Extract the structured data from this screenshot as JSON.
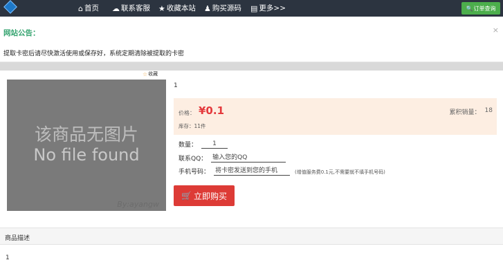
{
  "nav": {
    "items": [
      {
        "icon": "home-icon",
        "glyph": "🏠",
        "label": "首页"
      },
      {
        "icon": "support-icon",
        "glyph": "☁",
        "label": "联系客服"
      },
      {
        "icon": "star-icon",
        "glyph": "★",
        "label": "收藏本站"
      },
      {
        "icon": "users-icon",
        "glyph": "👥",
        "label": "购买源码"
      },
      {
        "icon": "more-icon",
        "glyph": "▤",
        "label": "更多>>"
      }
    ],
    "order_query_label": "订单查询"
  },
  "notice": {
    "title": "网站公告：",
    "close": "×",
    "text": "提取卡密后请尽快激活使用或保存好，系统定期清除被提取的卡密"
  },
  "product": {
    "favorite_label": "收藏",
    "image_text_cn": "该商品无图片",
    "image_text_en": "No file found",
    "image_signature": "By:ayangw",
    "name": "1",
    "price_label": "价格：",
    "price_value": "¥0.1",
    "sales_label": "累积销量：",
    "sales_value": "18",
    "stock_text": "库存：11件",
    "qty_label": "数量：",
    "qty_value": "1",
    "qq_label": "联系QQ：",
    "qq_placeholder": "输入您的QQ",
    "phone_label": "手机号码：",
    "phone_placeholder": "将卡密发送到您的手机",
    "phone_note": "(增值服务费0.1元,不需要就不填手机号码)",
    "buy_label": "立即购买"
  },
  "description": {
    "title": "商品描述",
    "content": "1"
  },
  "colors": {
    "navbar": "#2c3440",
    "accent_green": "#34a36f",
    "price_red": "#e4393c",
    "buy_red": "#dd3b36",
    "price_bg": "#fdeee2"
  }
}
